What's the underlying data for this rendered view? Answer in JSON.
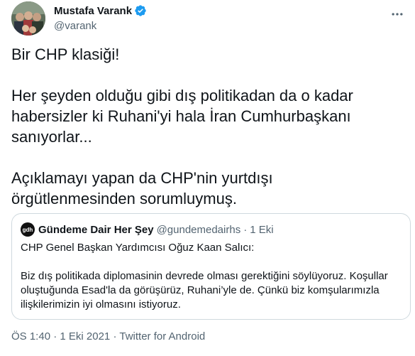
{
  "author": {
    "display_name": "Mustafa Varank",
    "handle": "@varank"
  },
  "tweet": {
    "paragraph1": "Bir CHP klasiği!",
    "paragraph2_line1": "Her şeyden olduğu gibi dış politikadan da o kadar",
    "paragraph2_line2": "habersizler ki Ruhani'yi hala İran Cumhurbaşkanı",
    "paragraph2_line3": "sanıyorlar...",
    "paragraph3_line1": "Açıklamayı yapan da CHP'nin yurtdışı",
    "paragraph3_line2": "örgütlenmesinden sorumluymuş."
  },
  "quote": {
    "avatar_text": "gdh",
    "display_name": "Gündeme Dair Her Şey",
    "handle": "@gundemedairhs",
    "separator": "·",
    "date": "1 Eki",
    "line1": "CHP Genel Başkan Yardımcısı Oğuz Kaan Salıcı:",
    "body_line1": "Biz dış politikada diplomasinin devrede olması gerektiğini söylüyoruz. Koşullar",
    "body_line2": "oluştuğunda Esad'la da görüşürüz, Ruhani’yle de. Çünkü biz komşularımızla",
    "body_line3": "ilişkilerimizin iyi olmasını istiyoruz."
  },
  "footer": {
    "time": "ÖS 1:40",
    "separator": "·",
    "date": "1 Eki 2021",
    "source": "Twitter for Android"
  },
  "colors": {
    "verified": "#1d9bf0",
    "secondary_text": "#536471",
    "border": "#cfd9de"
  }
}
